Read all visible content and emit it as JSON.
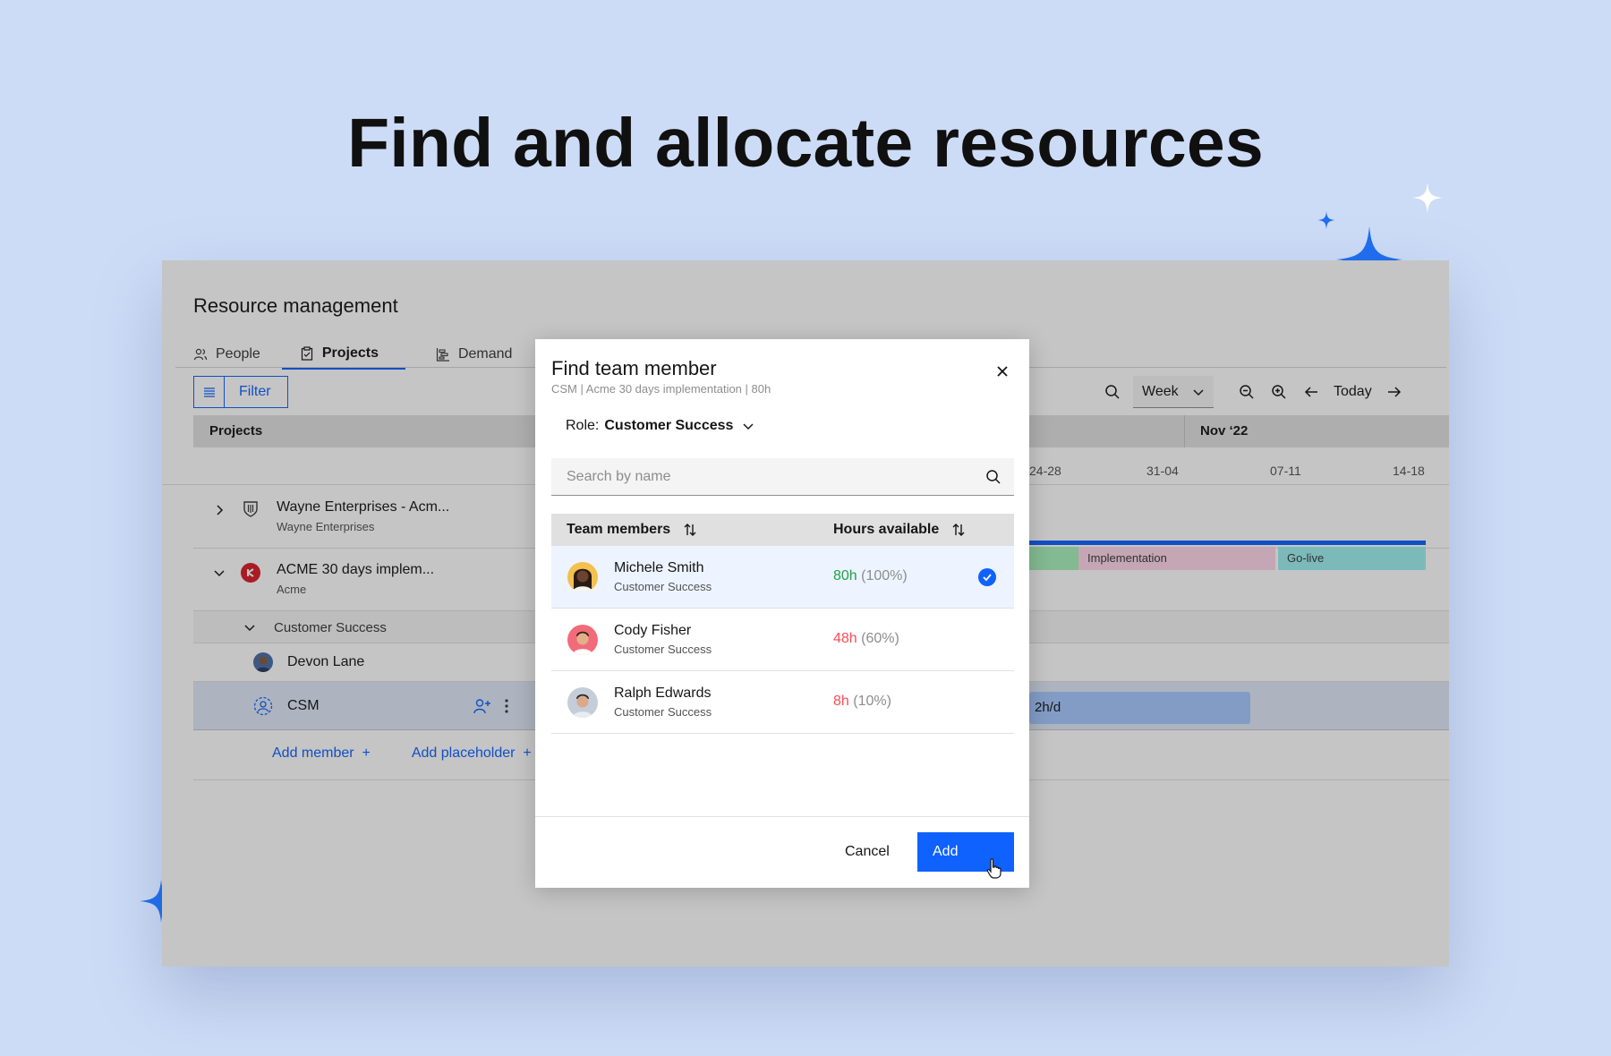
{
  "headline": "Find and allocate resources",
  "app": {
    "title": "Resource management",
    "tabs": [
      {
        "label": "People",
        "icon": "people-icon"
      },
      {
        "label": "Projects",
        "icon": "clipboard-icon",
        "active": true
      },
      {
        "label": "Demand",
        "icon": "gantt-icon"
      }
    ],
    "filter_label": "Filter",
    "view_select": "Week",
    "today_label": "Today",
    "grid_header": "Projects",
    "month": "Nov ‘22",
    "weeks": [
      "24-28",
      "31-04",
      "07-11",
      "14-18"
    ],
    "projects": [
      {
        "name": "Wayne Enterprises - Acm...",
        "client": "Wayne Enterprises"
      },
      {
        "name": "ACME 30 days implem...",
        "client": "Acme"
      }
    ],
    "group_label": "Customer Success",
    "member": "Devon Lane",
    "placeholder_row": "CSM",
    "phases": [
      "Implementation",
      "Go-live"
    ],
    "allocation_text": "2h/d",
    "add_member": "Add member",
    "add_placeholder": "Add placeholder"
  },
  "modal": {
    "title": "Find team member",
    "subtitle": "CSM | Acme 30 days implementation | 80h",
    "role_prefix": "Role:",
    "role_value": "Customer Success",
    "search_placeholder": "Search by name",
    "col_members": "Team members",
    "col_hours": "Hours available",
    "members": [
      {
        "name": "Michele Smith",
        "role": "Customer Success",
        "hours": "80h",
        "pct": "(100%)",
        "hours_color": "#24a148",
        "selected": true
      },
      {
        "name": "Cody Fisher",
        "role": "Customer Success",
        "hours": "48h",
        "pct": "(60%)",
        "hours_color": "#fa4d56",
        "selected": false
      },
      {
        "name": "Ralph Edwards",
        "role": "Customer Success",
        "hours": "8h",
        "pct": "(10%)",
        "hours_color": "#fa4d56",
        "selected": false
      }
    ],
    "cancel_label": "Cancel",
    "add_label": "Add"
  },
  "colors": {
    "accent": "#0f62fe",
    "background": "#cddcf6"
  }
}
